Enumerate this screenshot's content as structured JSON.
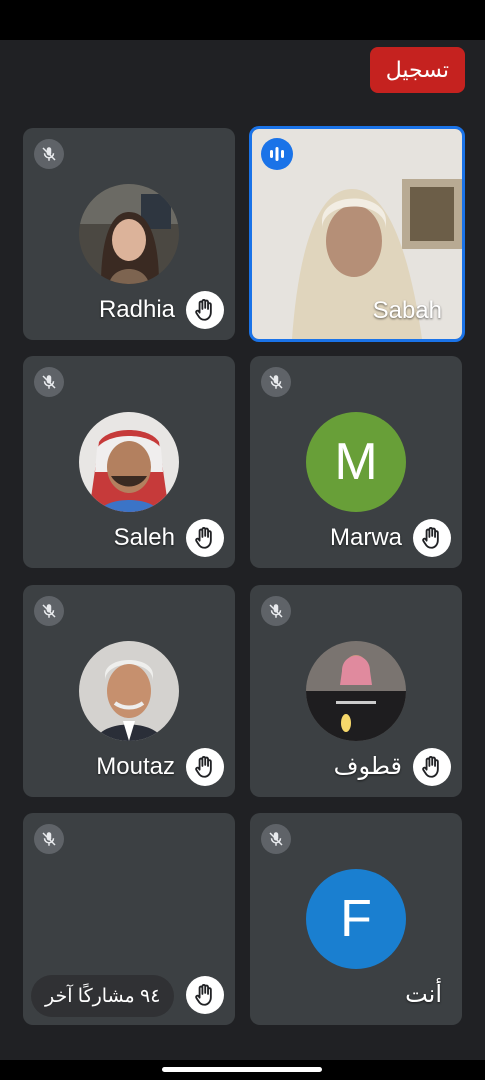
{
  "header": {
    "record_label": "تسجيل"
  },
  "participants": [
    {
      "name": "Radhia",
      "avatar": "photo"
    },
    {
      "name": "Sabah",
      "avatar": "video",
      "speaking": true
    },
    {
      "name": "Saleh",
      "avatar": "photo"
    },
    {
      "name": "Marwa",
      "avatar": "letter",
      "letter": "M",
      "color": "#689f38"
    },
    {
      "name": "Moutaz",
      "avatar": "photo"
    },
    {
      "name": "قطوف",
      "avatar": "photo"
    },
    {
      "name": "٩٤ مشاركًا آخر",
      "avatar": "none"
    },
    {
      "name": "أنت",
      "avatar": "letter",
      "letter": "F",
      "color": "#1a7fd0"
    }
  ],
  "icons": {
    "mic_off": "mic-off-icon",
    "raise_hand": "hand-icon",
    "speaking": "audio-wave-icon"
  },
  "colors": {
    "background": "#202124",
    "tile": "#3c4043",
    "record": "#c5221f",
    "active_border": "#1a73e8"
  }
}
